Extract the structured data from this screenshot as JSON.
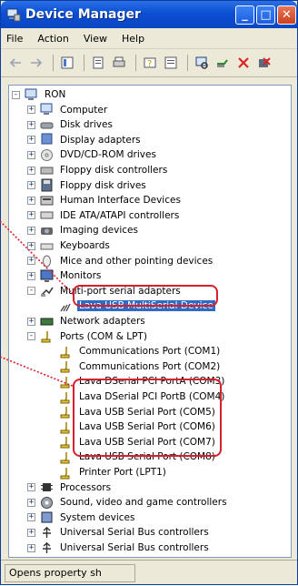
{
  "window": {
    "title": "Device Manager"
  },
  "menu": [
    "File",
    "Action",
    "View",
    "Help"
  ],
  "toolbar": [
    "back-icon",
    "forward-icon",
    "up-icon",
    "properties-icon",
    "print-icon",
    "help-icon",
    "details-icon",
    "scan-icon",
    "update-driver-icon",
    "uninstall-icon",
    "disable-icon"
  ],
  "tree": [
    {
      "label": "RON",
      "icon": "computer-icon",
      "level": 0,
      "exp": "-"
    },
    {
      "label": "Computer",
      "icon": "computer-icon",
      "level": 1,
      "exp": "+"
    },
    {
      "label": "Disk drives",
      "icon": "disk-icon",
      "level": 1,
      "exp": "+"
    },
    {
      "label": "Display adapters",
      "icon": "display-icon",
      "level": 1,
      "exp": "+"
    },
    {
      "label": "DVD/CD-ROM drives",
      "icon": "dvd-icon",
      "level": 1,
      "exp": "+"
    },
    {
      "label": "Floppy disk controllers",
      "icon": "controller-icon",
      "level": 1,
      "exp": "+"
    },
    {
      "label": "Floppy disk drives",
      "icon": "floppy-icon",
      "level": 1,
      "exp": "+"
    },
    {
      "label": "Human Interface Devices",
      "icon": "hid-icon",
      "level": 1,
      "exp": "+"
    },
    {
      "label": "IDE ATA/ATAPI controllers",
      "icon": "ide-icon",
      "level": 1,
      "exp": "+"
    },
    {
      "label": "Imaging devices",
      "icon": "camera-icon",
      "level": 1,
      "exp": "+"
    },
    {
      "label": "Keyboards",
      "icon": "keyboard-icon",
      "level": 1,
      "exp": "+"
    },
    {
      "label": "Mice and other pointing devices",
      "icon": "mouse-icon",
      "level": 1,
      "exp": "+"
    },
    {
      "label": "Monitors",
      "icon": "monitor-icon",
      "level": 1,
      "exp": "+"
    },
    {
      "label": "Multi-port serial adapters",
      "icon": "multiport-icon",
      "level": 1,
      "exp": "-"
    },
    {
      "label": "Lava USB MultiSerial Device",
      "icon": "serial-device-icon",
      "level": 2,
      "exp": "",
      "selected": true
    },
    {
      "label": "Network adapters",
      "icon": "network-icon",
      "level": 1,
      "exp": "+"
    },
    {
      "label": "Ports (COM & LPT)",
      "icon": "port-icon",
      "level": 1,
      "exp": "-"
    },
    {
      "label": "Communications Port (COM1)",
      "icon": "port-icon",
      "level": 2,
      "exp": ""
    },
    {
      "label": "Communications Port (COM2)",
      "icon": "port-icon",
      "level": 2,
      "exp": ""
    },
    {
      "label": "Lava DSerial PCI PortA (COM3)",
      "icon": "port-icon",
      "level": 2,
      "exp": ""
    },
    {
      "label": "Lava DSerial PCI PortB (COM4)",
      "icon": "port-icon",
      "level": 2,
      "exp": ""
    },
    {
      "label": "Lava USB Serial Port (COM5)",
      "icon": "port-icon",
      "level": 2,
      "exp": ""
    },
    {
      "label": "Lava USB Serial Port (COM6)",
      "icon": "port-icon",
      "level": 2,
      "exp": ""
    },
    {
      "label": "Lava USB Serial Port (COM7)",
      "icon": "port-icon",
      "level": 2,
      "exp": ""
    },
    {
      "label": "Lava USB Serial Port (COM8)",
      "icon": "port-icon",
      "level": 2,
      "exp": ""
    },
    {
      "label": "Printer Port (LPT1)",
      "icon": "port-icon",
      "level": 2,
      "exp": ""
    },
    {
      "label": "Processors",
      "icon": "processor-icon",
      "level": 1,
      "exp": "+"
    },
    {
      "label": "Sound, video and game controllers",
      "icon": "sound-icon",
      "level": 1,
      "exp": "+"
    },
    {
      "label": "System devices",
      "icon": "system-icon",
      "level": 1,
      "exp": "+"
    },
    {
      "label": "Universal Serial Bus controllers",
      "icon": "usb-icon",
      "level": 1,
      "exp": "+"
    },
    {
      "label": "Universal Serial Bus controllers",
      "icon": "usb-icon",
      "level": 1,
      "exp": "+"
    }
  ],
  "status": {
    "text": "Opens property sh"
  },
  "colors": {
    "callout": "#d71f2e",
    "selection": "#316ac5",
    "titlebar": "#0b4fd4"
  }
}
